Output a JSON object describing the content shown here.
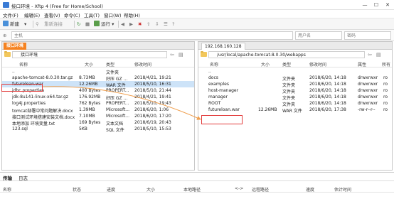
{
  "window": {
    "title": "接口环境 - Xftp 4 (Free for Home/School)",
    "min": "—",
    "max": "☐",
    "close": "✕"
  },
  "menu": [
    "文件(F)",
    "编辑(E)",
    "查看(V)",
    "命令(C)",
    "工具(T)",
    "窗口(W)",
    "帮助(H)"
  ],
  "toolbar": {
    "new": "新建",
    "reconnect": "重新连接",
    "run": "运行"
  },
  "addressbar": {
    "host_placeholder": "主机",
    "user_placeholder": "用户名",
    "password_placeholder": "密码"
  },
  "left": {
    "tab": "接口环境",
    "path": "接口环境",
    "columns": [
      "名称",
      "大小",
      "类型",
      "修改时间"
    ],
    "files": [
      {
        "name": "..",
        "size": "",
        "type": "文件夹",
        "mtime": "",
        "icon": "folder"
      },
      {
        "name": "apache-tomcat-8.0.30.tar.gz",
        "size": "8.73MB",
        "type": "好压 GZ ...",
        "mtime": "2018/4/21, 19:21",
        "icon": "file"
      },
      {
        "name": "futureloan.war",
        "size": "12.26MB",
        "type": "WAR 文件",
        "mtime": "2018/5/10, 16:31",
        "icon": "file"
      },
      {
        "name": "jdbc.properties",
        "size": "400 Bytes",
        "type": "PROPERT...",
        "mtime": "2018/5/10, 21:44",
        "icon": "file"
      },
      {
        "name": "jdk-8u141-linux-x64.tar.gz",
        "size": "176.92MB",
        "type": "好压 GZ ...",
        "mtime": "2018/4/21, 19:41",
        "icon": "file"
      },
      {
        "name": "log4j.properties",
        "size": "762 Bytes",
        "type": "PROPERT...",
        "mtime": "2018/5/10, 19:43",
        "icon": "file"
      },
      {
        "name": "tomcat部署中常问题解决.docx",
        "size": "1.39MB",
        "type": "Microsoft...",
        "mtime": "2018/6/20, 1:06",
        "icon": "file"
      },
      {
        "name": "接口测试环境搭建安装文档.docx",
        "size": "7.10MB",
        "type": "Microsoft...",
        "mtime": "2018/6/20, 17:20",
        "icon": "file"
      },
      {
        "name": "本地添加 环境变量.txt",
        "size": "169 Bytes",
        "type": "文本文档",
        "mtime": "2018/6/19, 20:43",
        "icon": "file"
      },
      {
        "name": "123.sql",
        "size": "5KB",
        "type": "SQL 文件",
        "mtime": "2018/5/10, 15:53",
        "icon": "file"
      }
    ]
  },
  "right": {
    "tab": "192.168.160.128",
    "path": "/usr/local/apache-tomcat-8.0.30/webapps",
    "columns": [
      "名称",
      "大小",
      "类型",
      "修改时间",
      "属性",
      "所有"
    ],
    "files": [
      {
        "name": "..",
        "size": "",
        "type": "",
        "mtime": "",
        "attr": "",
        "owner": "",
        "icon": "folder"
      },
      {
        "name": "docs",
        "size": "",
        "type": "文件夹",
        "mtime": "2018/6/20, 14:18",
        "attr": "drwxrwxr",
        "owner": "ro",
        "icon": "folder"
      },
      {
        "name": "examples",
        "size": "",
        "type": "文件夹",
        "mtime": "2018/6/20, 14:18",
        "attr": "drwxrwxr",
        "owner": "ro",
        "icon": "folder"
      },
      {
        "name": "host-manager",
        "size": "",
        "type": "文件夹",
        "mtime": "2018/6/20, 14:18",
        "attr": "drwxrwxr",
        "owner": "ro",
        "icon": "folder"
      },
      {
        "name": "manager",
        "size": "",
        "type": "文件夹",
        "mtime": "2018/6/20, 14:18",
        "attr": "drwxrwxr",
        "owner": "ro",
        "icon": "folder"
      },
      {
        "name": "ROOT",
        "size": "",
        "type": "文件夹",
        "mtime": "2018/6/20, 14:18",
        "attr": "drwxrwxr",
        "owner": "ro",
        "icon": "folder"
      },
      {
        "name": "futureloan.war",
        "size": "12.26MB",
        "type": "WAR 文件",
        "mtime": "2018/6/20, 17:38",
        "attr": "-rw-r--r--",
        "owner": "ro",
        "icon": "file"
      }
    ]
  },
  "bottom": {
    "tabs": [
      "传输",
      "日志"
    ],
    "columns": [
      "名称",
      "状态",
      "进度",
      "大小",
      "本地路径",
      "<->",
      "远程路径",
      "速度",
      "估计时间"
    ]
  },
  "colors": {
    "accent": "#f58220",
    "highlight": "#e23b3b",
    "selection": "#cde3f8"
  }
}
